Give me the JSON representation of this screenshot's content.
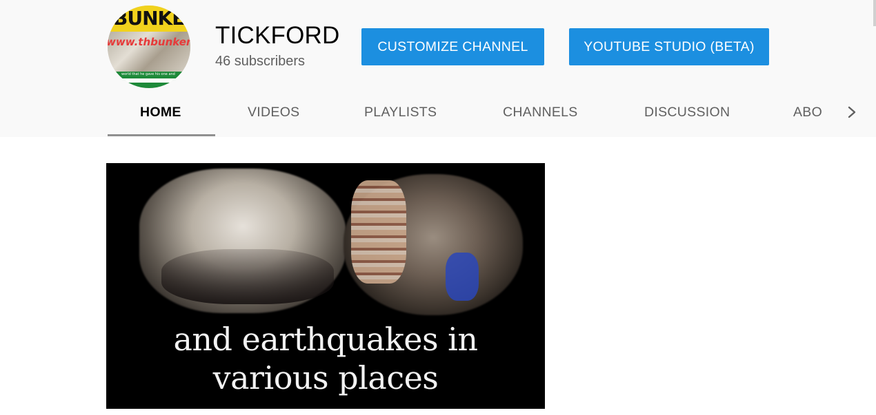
{
  "channel": {
    "name": "TICKFORD",
    "subscribers": "46 subscribers",
    "avatar": {
      "banner_word": "BUNKER",
      "url_text": "www.thbunker.com",
      "tagline": "world that he gave his one and"
    }
  },
  "actions": {
    "customize_label": "CUSTOMIZE CHANNEL",
    "studio_label": "YOUTUBE STUDIO (BETA)"
  },
  "tabs": [
    {
      "label": "HOME",
      "active": true
    },
    {
      "label": "VIDEOS",
      "active": false
    },
    {
      "label": "PLAYLISTS",
      "active": false
    },
    {
      "label": "CHANNELS",
      "active": false
    },
    {
      "label": "DISCUSSION",
      "active": false
    },
    {
      "label": "ABO",
      "active": false
    }
  ],
  "icons": {
    "next_tabs": "chevron-right-icon"
  },
  "featured_video": {
    "caption_line1": "and earthquakes in",
    "caption_line2": "various places"
  },
  "colors": {
    "accent": "#1c8fe0",
    "header_bg": "#f9f9f9",
    "tab_underline": "#909090"
  }
}
